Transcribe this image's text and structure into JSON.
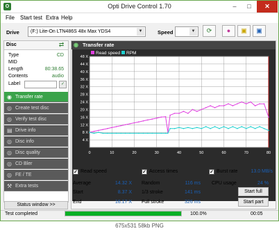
{
  "window": {
    "title": "Opti Drive Control 1.70",
    "min": "–",
    "max": "□",
    "close": "✕"
  },
  "menu": [
    "File",
    "Start test",
    "Extra",
    "Help"
  ],
  "toolbar": {
    "drive_label": "Drive",
    "drive_value": "(F:)  Lite-On LTN486S 48x Max YDS4",
    "speed_label": "Speed",
    "speed_value": "",
    "icons": [
      "refresh-icon",
      "eraser-icon",
      "cdbox-icon",
      "save-icon"
    ]
  },
  "disc": {
    "header": "Disc",
    "rows": [
      {
        "key": "Type",
        "value": "CD"
      },
      {
        "key": "MID",
        "value": ""
      },
      {
        "key": "Length",
        "value": "80:38.65"
      },
      {
        "key": "Contents",
        "value": "audio"
      }
    ],
    "label_key": "Label",
    "label_value": ""
  },
  "nav": [
    {
      "label": "Transfer rate",
      "selected": true
    },
    {
      "label": "Create test disc",
      "selected": false
    },
    {
      "label": "Verify test disc",
      "selected": false
    },
    {
      "label": "Drive info",
      "selected": false
    },
    {
      "label": "Disc info",
      "selected": false
    },
    {
      "label": "Disc quality",
      "selected": false
    },
    {
      "label": "CD Bler",
      "selected": false
    },
    {
      "label": "FE / TE",
      "selected": false
    },
    {
      "label": "Extra tests",
      "selected": false
    }
  ],
  "status_window_label": "Status window >>",
  "panel_title": "Transfer rate",
  "chart_data": {
    "type": "line",
    "legend": [
      "Read speed",
      "RPM"
    ],
    "legend_position": "top-left",
    "colors": {
      "read_speed": "#e040e0",
      "rpm": "#20d0d0",
      "marker": "#c00000",
      "grid": "#8a8a8a"
    },
    "xlim": [
      0,
      80
    ],
    "ylim": [
      0,
      48
    ],
    "x_ticks": [
      "0",
      "10",
      "20",
      "30",
      "40",
      "50",
      "60",
      "70",
      "80"
    ],
    "y_ticks": [
      "48 X",
      "44 X",
      "40 X",
      "36 X",
      "32 X",
      "28 X",
      "24 X",
      "20 X",
      "16 X",
      "12 X",
      "8 X",
      "4 X"
    ],
    "marker_x": 80,
    "grid": true,
    "series": [
      {
        "name": "Read speed",
        "x": [
          0,
          2,
          4,
          6,
          8,
          10,
          12,
          14,
          16,
          18,
          20,
          22,
          24,
          26,
          28,
          30,
          32,
          34,
          35,
          36,
          38,
          40,
          42,
          44,
          46,
          48,
          50,
          52,
          54,
          56,
          58,
          60,
          62,
          64,
          66,
          68,
          70,
          72,
          74,
          76,
          78,
          80
        ],
        "values": [
          8,
          8.5,
          9,
          9.5,
          10,
          10.5,
          11,
          11.5,
          12,
          12.5,
          13,
          13.5,
          14,
          14.5,
          15,
          15.5,
          16,
          16.2,
          8,
          17,
          18,
          18,
          19,
          18,
          20,
          19,
          20,
          21,
          22,
          21,
          22,
          22,
          23,
          22,
          23,
          24,
          23,
          24,
          22,
          23,
          23,
          16
        ]
      },
      {
        "name": "RPM",
        "x": [
          0,
          2,
          4,
          6,
          8,
          10,
          12,
          14,
          16,
          18,
          20,
          22,
          24,
          26,
          28,
          30,
          32,
          34,
          35,
          36,
          38,
          40,
          42,
          44,
          46,
          48,
          50,
          52,
          54,
          56,
          58,
          60,
          62,
          64,
          66,
          68,
          70,
          72,
          74,
          76,
          78,
          80
        ],
        "values": [
          8,
          7.5,
          8,
          7.5,
          7.5,
          7.5,
          7.5,
          7.5,
          7.5,
          7.5,
          7.5,
          7.5,
          7.5,
          7.5,
          7.5,
          7.5,
          7.5,
          7.5,
          7.5,
          10,
          10,
          10.5,
          10,
          10.5,
          10,
          10.5,
          10,
          11,
          10,
          11,
          10,
          11,
          10,
          11,
          10,
          11,
          10,
          11,
          10,
          11,
          10,
          9
        ]
      }
    ]
  },
  "checks": {
    "read_speed": "Read speed",
    "access_times": "Access times",
    "burst_rate": "Burst rate",
    "burst_value": "13.0 MB/s"
  },
  "stats": {
    "average_label": "Average",
    "average_value": "14.32 X",
    "start_label": "Start",
    "start_value": "8.37 X",
    "end_label": "End",
    "end_value": "16.17 X",
    "random_label": "Random",
    "random_value": "116 ms",
    "third_label": "1/3 stroke",
    "third_value": "141 ms",
    "full_label": "Full stroke",
    "full_value": "326 ms",
    "cpu_label": "CPU usage",
    "cpu_value": "24 %"
  },
  "buttons": {
    "start_full": "Start full",
    "start_part": "Start part"
  },
  "statusbar": {
    "left": "Test completed",
    "progress_text": "100.0%",
    "progress": 1.0,
    "elapsed": "",
    "time": "00:05"
  },
  "caption": "675x531  58kb  PNG"
}
